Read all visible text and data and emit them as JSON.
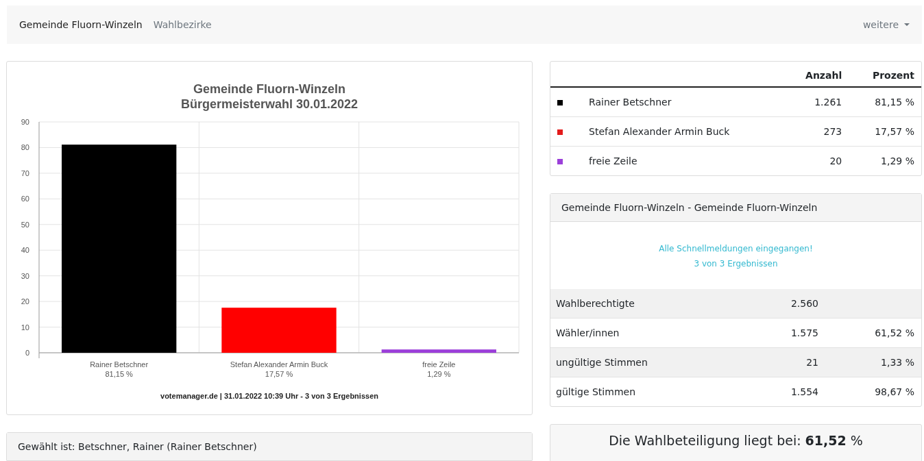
{
  "navbar": {
    "brand": "Gemeinde Fluorn-Winzeln",
    "links": [
      {
        "label": "Wahlbezirke"
      }
    ],
    "dropdown": {
      "label": "weitere"
    }
  },
  "chart_card": {
    "chart_data": {
      "type": "bar",
      "title": "Gemeinde Fluorn-Winzeln\nBürgermeisterwahl 30.01.2022",
      "categories": [
        "Rainer Betschner",
        "Stefan Alexander Armin Buck",
        "freie Zeile"
      ],
      "values": [
        81.15,
        17.57,
        1.29
      ],
      "grid": true,
      "colors": [
        "#000000",
        "#ff0000",
        "#9b3fd9"
      ],
      "value_labels": [
        "81,15 %",
        "17,57 %",
        "1,29 %"
      ],
      "ylim": [
        0,
        90
      ],
      "yticks": [
        0,
        10,
        20,
        30,
        40,
        50,
        60,
        70,
        80,
        90
      ]
    },
    "footer": "votemanager.de | 31.01.2022 10:39 Uhr - 3 von 3 Ergebnissen"
  },
  "results_table": {
    "columns": [
      "Anzahl",
      "Prozent"
    ],
    "rows": [
      {
        "name": "Rainer Betschner",
        "color": "#000000",
        "count": "1.261",
        "percent": "81,15 %"
      },
      {
        "name": "Stefan Alexander Armin Buck",
        "color": "#e31b1b",
        "count": "273",
        "percent": "17,57 %"
      },
      {
        "name": "freie Zeile",
        "color": "#9b3fd9",
        "count": "20",
        "percent": "1,29 %"
      }
    ]
  },
  "status_card": {
    "title": "Gemeinde Fluorn-Winzeln - Gemeinde Fluorn-Winzeln",
    "message": [
      "Alle Schnellmeldungen eingegangen!",
      "3 von 3 Ergebnissen"
    ],
    "rows": [
      {
        "label": "Wahlberechtigte",
        "value": "2.560"
      },
      {
        "label": "Wähler/innen",
        "value": "1.575",
        "percent": "61,52 %"
      },
      {
        "label": "ungültige Stimmen",
        "value": "21",
        "percent": "1,33 %"
      },
      {
        "label": "gültige Stimmen",
        "value": "1.554",
        "percent": "98,67 %"
      }
    ]
  },
  "elected_card": {
    "title": "Gewählt ist: Betschner, Rainer (Rainer Betschner)"
  },
  "turnout_card": {
    "text": "Die Wahlbeteiligung liegt bei: **61,52** %"
  }
}
